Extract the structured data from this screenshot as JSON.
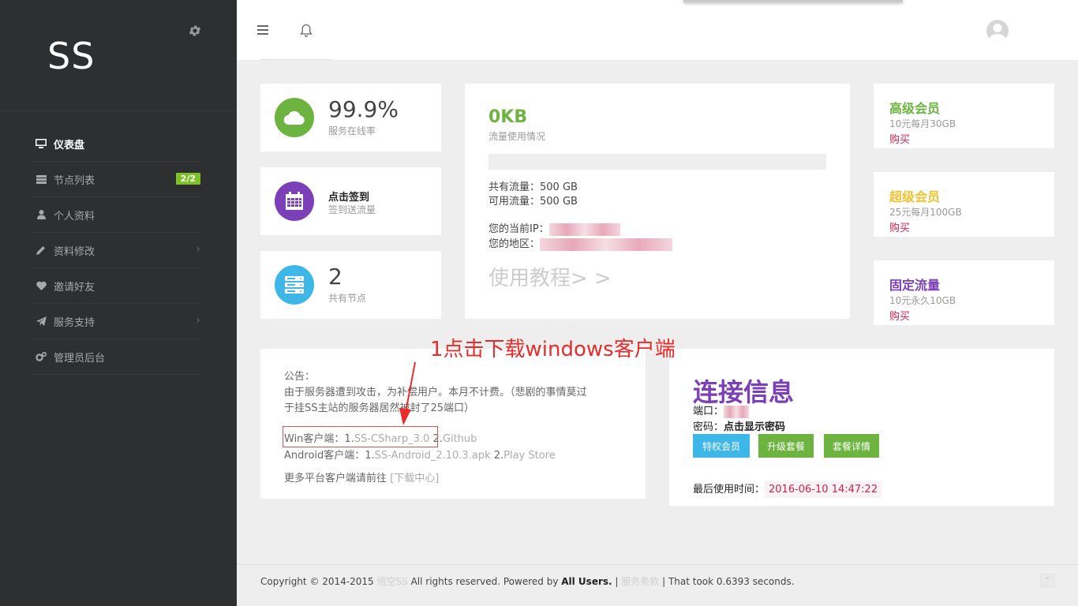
{
  "sidebar": {
    "logo": "SS",
    "items": [
      {
        "label": "仪表盘"
      },
      {
        "label": "节点列表",
        "badge": "2/2"
      },
      {
        "label": "个人资料"
      },
      {
        "label": "资料修改"
      },
      {
        "label": "邀请好友"
      },
      {
        "label": "服务支持"
      },
      {
        "label": "管理员后台"
      }
    ],
    "chevron": "›"
  },
  "stats": {
    "uptime_value": "99.9%",
    "uptime_label": "服务在线率",
    "checkin_title": "点击签到",
    "checkin_label": "签到送流量",
    "nodes_value": "2",
    "nodes_label": "共有节点"
  },
  "traffic": {
    "used": "0KB",
    "label": "流量使用情况",
    "usage_fraction": 0,
    "total": "共有流量：500 GB",
    "available": "可用流量：500 GB",
    "ip_label": "您的当前IP：",
    "region_label": "您的地区：",
    "tutorial": "使用教程> >"
  },
  "plans": [
    {
      "title": "高级会员",
      "desc": "10元每月30GB",
      "buy": "购买",
      "color": "#6db33f"
    },
    {
      "title": "超级会员",
      "desc": "25元每月100GB",
      "buy": "购买",
      "color": "#f0c330"
    },
    {
      "title": "固定流量",
      "desc": "10元永久10GB",
      "buy": "购买",
      "color": "#7b3fb8"
    }
  ],
  "announcement": {
    "heading": "公告：",
    "body1": "由于服务器遭到攻击，为补偿用户。本月不计费。（悲剧的事情莫过",
    "body2": "于挂SS主站的服务器居然被封了25端口）",
    "win_label": "Win客户端：1.",
    "win_link1": "SS-CSharp_3.0",
    "win_sep": " 2.",
    "win_link2": "Github",
    "android_label": "Android客户端：1.",
    "android_link1": "SS-Android_2.10.3.apk",
    "android_sep": " 2.",
    "android_link2": "Play Store",
    "more_label": "更多平台客户端请前往 ",
    "more_link": "[下载中心]"
  },
  "annotation": "1点击下载windows客户端",
  "connection": {
    "title": "连接信息",
    "port_label": "端口：",
    "password_label": "密码：",
    "password_value": "点击显示密码",
    "btn_privilege": "特权会员",
    "btn_upgrade": "升级套餐",
    "btn_details": "套餐详情",
    "last_used_label": "最后使用时间：",
    "last_used_value": "2016-06-10 14:47:22"
  },
  "footer": {
    "copyright": "Copyright © 2014-2015 ",
    "site": "悟空SS",
    "rights": " All rights reserved. Powered by ",
    "powered_by": "All Users.",
    "sep1": " | ",
    "terms": "服务条款",
    "sep2": " | That took 0.6393 seconds."
  },
  "scroll_top": "⌃",
  "colors": {
    "green": "#6db33f",
    "purple": "#7b3fb8",
    "blue": "#3db6e8",
    "yellow": "#f0c330",
    "red": "#c7254e"
  },
  "icons": [
    "gear-icon",
    "menu-icon",
    "bell-icon",
    "avatar-icon",
    "cloud-icon",
    "calendar-icon",
    "server-icon",
    "monitor-icon",
    "list-icon",
    "user-icon",
    "pencil-icon",
    "heart-icon",
    "send-icon",
    "cogs-icon"
  ]
}
